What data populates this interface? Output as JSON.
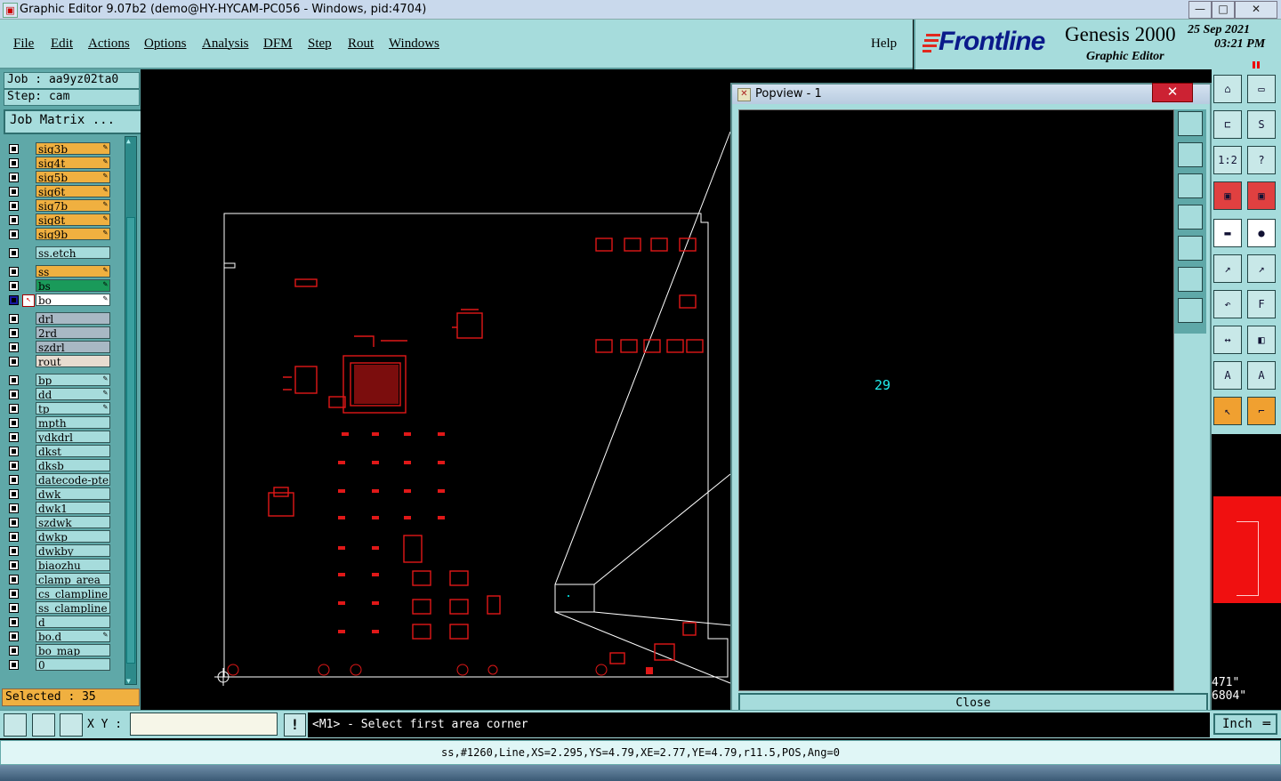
{
  "window": {
    "title": "Graphic Editor 9.07b2 (demo@HY-HYCAM-PC056 - Windows, pid:4704)",
    "controls": {
      "minimize": "—",
      "maximize": "□",
      "close": "✕"
    }
  },
  "menu": {
    "items": [
      "File",
      "Edit",
      "Actions",
      "Options",
      "Analysis",
      "DFM",
      "Step",
      "Rout",
      "Windows"
    ],
    "help": "Help"
  },
  "brand": {
    "logo": "Frontline",
    "product": "Genesis 2000",
    "subtitle": "Graphic Editor",
    "date": "25 Sep 2021",
    "time": "03:21 PM"
  },
  "job": {
    "job_line": "Job : aa9yz02ta0",
    "step_line": "Step: cam",
    "matrix_button": "Job Matrix ..."
  },
  "layers": [
    {
      "name": "sig3b",
      "color": "#f0b040",
      "editable": true
    },
    {
      "name": "sig4t",
      "color": "#f0b040",
      "editable": true
    },
    {
      "name": "sig5b",
      "color": "#f0b040",
      "editable": true
    },
    {
      "name": "sig6t",
      "color": "#f0b040",
      "editable": true
    },
    {
      "name": "sig7b",
      "color": "#f0b040",
      "editable": true
    },
    {
      "name": "sig8t",
      "color": "#f0b040",
      "editable": true
    },
    {
      "name": "sig9b",
      "color": "#f0b040",
      "editable": true
    },
    {
      "name": "ss.etch",
      "color": "#a6dcdc",
      "editable": false,
      "gap": true
    },
    {
      "name": "ss",
      "color": "#f0b040",
      "editable": true,
      "gap": true
    },
    {
      "name": "bs",
      "color": "#1a9a5a",
      "editable": true
    },
    {
      "name": "bo",
      "color": "#ffffff",
      "editable": true,
      "active": true
    },
    {
      "name": "drl",
      "color": "#a8b8c4",
      "editable": false,
      "gap": true
    },
    {
      "name": "2rd",
      "color": "#a8b8c4",
      "editable": false
    },
    {
      "name": "szdrl",
      "color": "#a8b8c4",
      "editable": false
    },
    {
      "name": "rout",
      "color": "#e8dcd0",
      "editable": false
    },
    {
      "name": "bp",
      "color": "#a6dcdc",
      "editable": true,
      "gap": true
    },
    {
      "name": "dd",
      "color": "#a6dcdc",
      "editable": true
    },
    {
      "name": "tp",
      "color": "#a6dcdc",
      "editable": true
    },
    {
      "name": "mpth",
      "color": "#a6dcdc",
      "editable": false
    },
    {
      "name": "ydkdrl",
      "color": "#a6dcdc",
      "editable": false
    },
    {
      "name": "dkst",
      "color": "#a6dcdc",
      "editable": false
    },
    {
      "name": "dksb",
      "color": "#a6dcdc",
      "editable": false
    },
    {
      "name": "datecode-pte",
      "color": "#a6dcdc",
      "editable": false
    },
    {
      "name": "dwk",
      "color": "#a6dcdc",
      "editable": false
    },
    {
      "name": "dwk1",
      "color": "#a6dcdc",
      "editable": false
    },
    {
      "name": "szdwk",
      "color": "#a6dcdc",
      "editable": false
    },
    {
      "name": "dwkp",
      "color": "#a6dcdc",
      "editable": false
    },
    {
      "name": "dwkby",
      "color": "#a6dcdc",
      "editable": false
    },
    {
      "name": "biaozhu",
      "color": "#a6dcdc",
      "editable": false
    },
    {
      "name": "clamp_area",
      "color": "#a6dcdc",
      "editable": false
    },
    {
      "name": "cs_clampline",
      "color": "#a6dcdc",
      "editable": false
    },
    {
      "name": "ss_clampline",
      "color": "#a6dcdc",
      "editable": false
    },
    {
      "name": "d",
      "color": "#a6dcdc",
      "editable": false
    },
    {
      "name": "bo.d",
      "color": "#a6dcdc",
      "editable": true
    },
    {
      "name": "bo_map",
      "color": "#a6dcdc",
      "editable": false
    },
    {
      "name": "0",
      "color": "#a6dcdc",
      "editable": false
    }
  ],
  "selected": "Selected : 35",
  "popview": {
    "title": "Popview - 1",
    "value": "29",
    "close_label": "Close"
  },
  "coords": {
    "x": "471\"",
    "y": "6804\""
  },
  "bottom": {
    "xy_label": "X Y :",
    "xy_value": "",
    "prompt": "<M1> - Select first area corner",
    "units": "Inch"
  },
  "status": "ss,#1260,Line,XS=2.295,YS=4.79,XE=2.77,YE=4.79,r11.5,POS,Ang=0"
}
